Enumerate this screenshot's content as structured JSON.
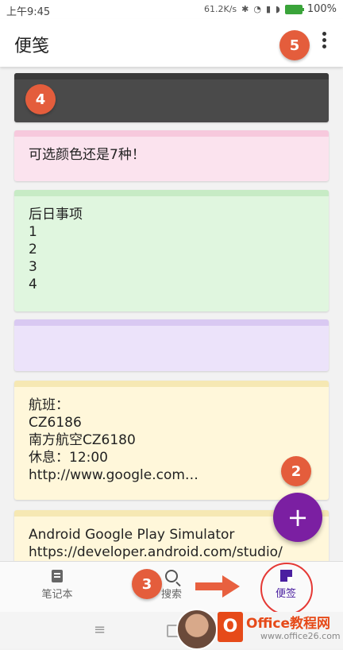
{
  "status_bar": {
    "time": "上午9:45",
    "speed": "61.2K/s",
    "battery": "100%"
  },
  "app_bar": {
    "title": "便笺"
  },
  "notes": [
    {
      "color": "#4a4a4a",
      "text": ""
    },
    {
      "color": "#fbe3ee",
      "text": "可选颜色还是7种！"
    },
    {
      "color": "#e0f6df",
      "text": "后日事项\n1\n2\n3\n4"
    },
    {
      "color": "#ece3fa",
      "text": ""
    },
    {
      "color": "#fff7da",
      "text": "航班：\nCZ6186\n南方航空CZ6180\n休息：12:00\nhttp://www.google.com…"
    },
    {
      "color": "#fff7da",
      "text": "Android Google Play Simulator\nhttps://developer.android.com/studio/"
    }
  ],
  "markers": {
    "m2": "2",
    "m3": "3",
    "m4": "4",
    "m5": "5"
  },
  "fab": {
    "label": "+"
  },
  "bottom_nav": {
    "notebook": "笔记本",
    "search": "搜索",
    "memo": "便签"
  },
  "watermark": {
    "title": "Office教程网",
    "url": "www.office26.com"
  }
}
